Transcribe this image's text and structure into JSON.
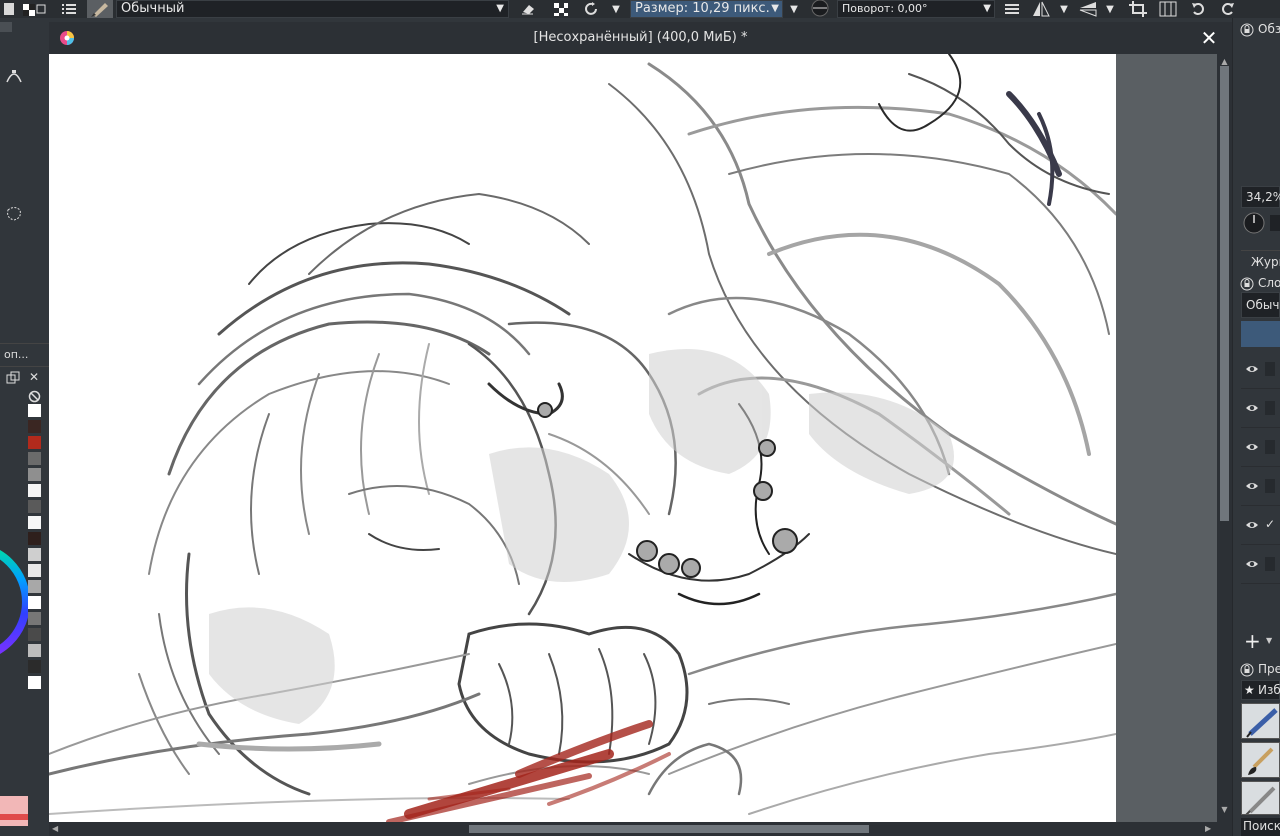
{
  "toolbar": {
    "blend_mode": "Обычный",
    "brush_size": "Размер: 10,29 пикс.",
    "rotation": "Поворот: 0,00°"
  },
  "window": {
    "title": "[Несохранённый]  (400,0 МиБ) *",
    "close_glyph": "✕"
  },
  "left_docker": {
    "tab_label": "оп...",
    "palette_colors": [
      "#ffffff",
      "#3a2622",
      "#b22a1c",
      "#6b6b6b",
      "#8f8f8f",
      "#f4f4f4",
      "#5a5a5a",
      "#f7f7f7",
      "#2e1f1c",
      "#cfcfcf",
      "#e8e8e8",
      "#a8a8a8",
      "#ffffff",
      "#777777",
      "#4a4a4a",
      "#bdbdbd",
      "#2b2b2b",
      "#ffffff"
    ]
  },
  "right_docker": {
    "overview_title": "Обз",
    "zoom_value": "34,2%",
    "history_tab": "Журн",
    "layers_title": "Сло",
    "layer_blend": "Обыч",
    "layer_checkmark": "✓",
    "add_glyph": "+",
    "brush_presets_title": "Пре",
    "favorites_tag": "Избр",
    "search_label": "Поиск"
  },
  "colors": {
    "accent": "#3d5a7a",
    "blood": "#a3241b"
  }
}
